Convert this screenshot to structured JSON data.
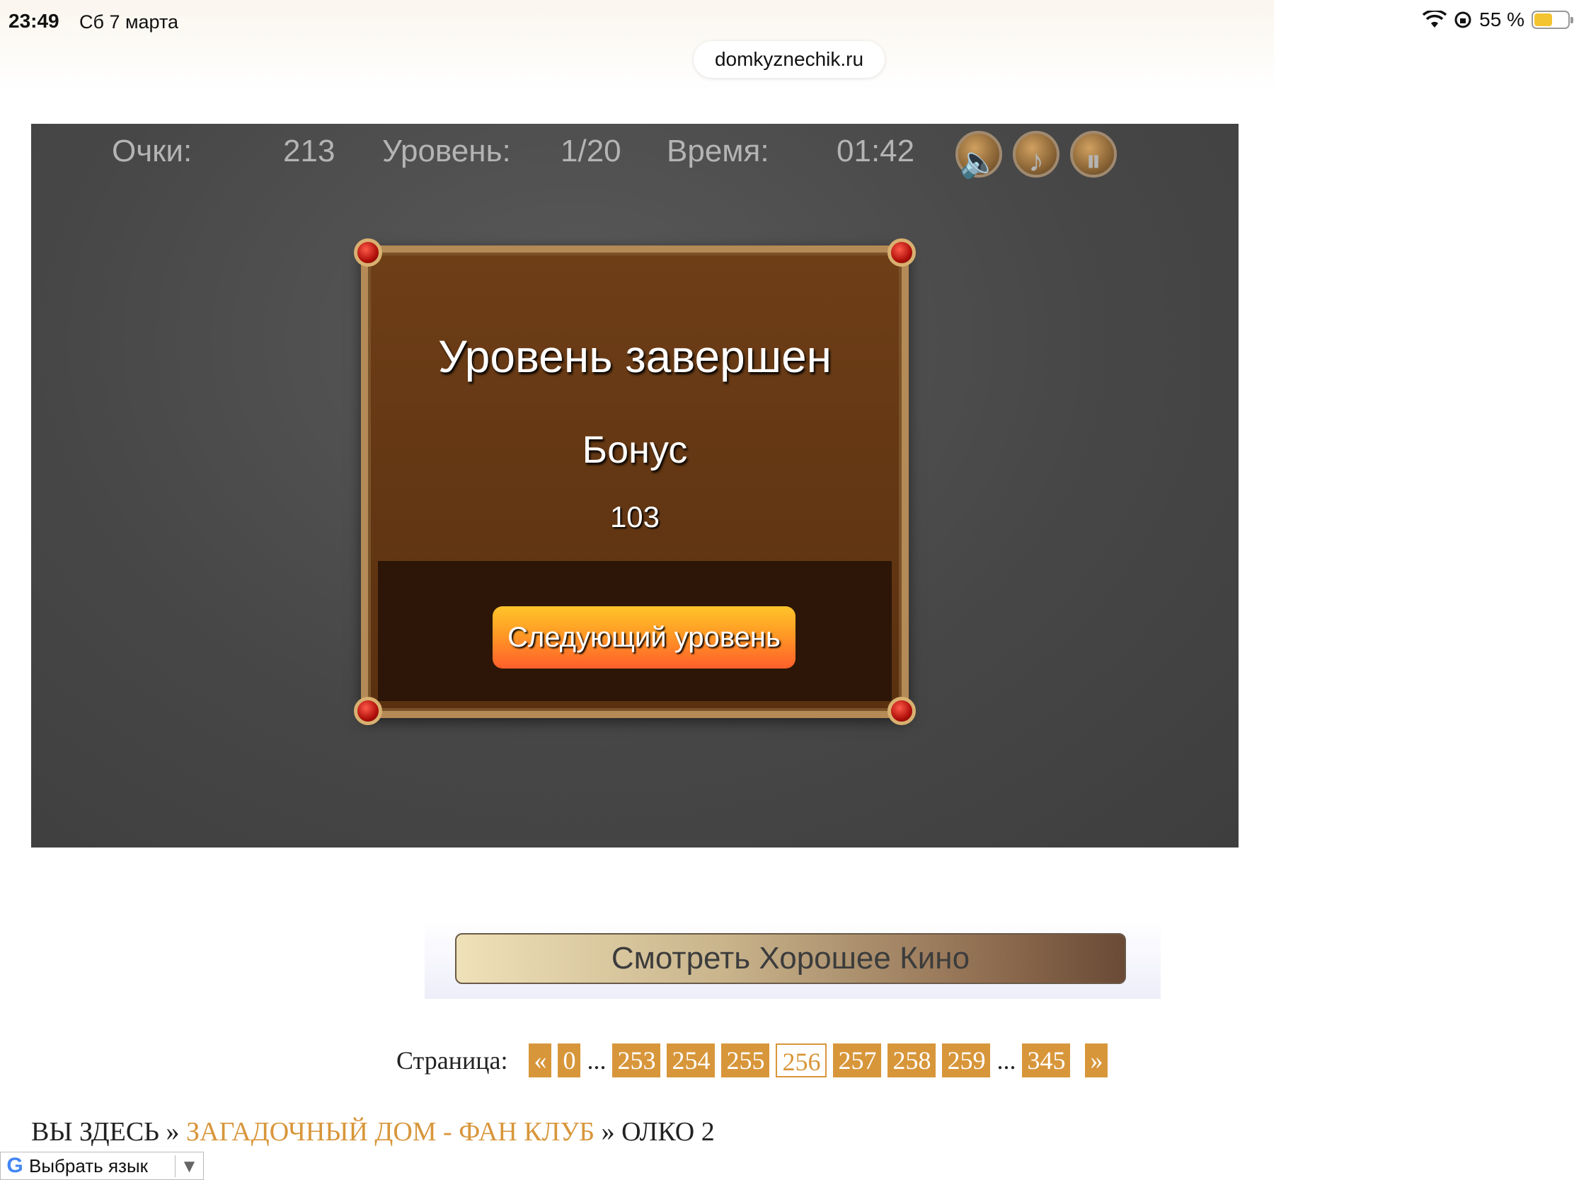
{
  "status_bar": {
    "time": "23:49",
    "date": "Сб 7 марта",
    "battery": "55 %",
    "battery_level": 0.55,
    "wifi_icon": "wifi-icon",
    "lock_icon": "orientation-lock-icon"
  },
  "browser": {
    "url": "domkyznechik.ru"
  },
  "game": {
    "hud": {
      "score_label": "Очки:",
      "score_value": "213",
      "level_label": "Уровень:",
      "level_value": "1/20",
      "time_label": "Время:",
      "time_value": "01:42"
    },
    "buttons": {
      "sound_glyph": "🔈",
      "music_glyph": "♪",
      "pause_glyph": "⏸"
    },
    "dialog": {
      "title": "Уровень завершен",
      "bonus_label": "Бонус",
      "bonus_value": "103",
      "next_button": "Следующий уровень"
    }
  },
  "watch_button": "Смотреть Хорошее Кино",
  "pagination": {
    "label": "Страница:",
    "prev": "«",
    "first": "0",
    "dots": "...",
    "pages": [
      "253",
      "254",
      "255",
      "256",
      "257",
      "258",
      "259"
    ],
    "current": "256",
    "last": "345",
    "next": "»"
  },
  "breadcrumb": {
    "you_are_here": "ВЫ ЗДЕСЬ",
    "sep": "»",
    "section": "ЗАГАДОЧНЫЙ ДОМ - ФАН КЛУБ",
    "page": "ОЛКО 2"
  },
  "translate": {
    "logo": "G",
    "label": "Выбрать язык",
    "arrow": "▼"
  },
  "colors": {
    "accent": "#d8963a",
    "game_bg": "#474747",
    "dialog_bg": "#6e3e17"
  }
}
